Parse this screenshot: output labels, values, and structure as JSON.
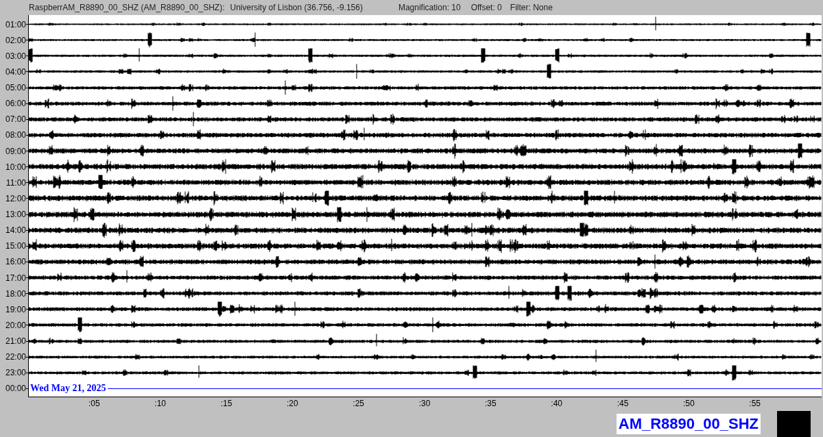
{
  "header": {
    "station": "RaspberrAM_R8890_00_SHZ (AM_R8890_00_SHZ):",
    "location": "University of Lisbon (36.756, -9.156)",
    "magnification": "Magnification: 10",
    "offset": "Offset: 0",
    "filter": "Filter: None"
  },
  "rows": [
    {
      "label": "01:00",
      "kind": "trace"
    },
    {
      "label": "02:00",
      "kind": "trace"
    },
    {
      "label": "03:00",
      "kind": "trace"
    },
    {
      "label": "04:00",
      "kind": "trace"
    },
    {
      "label": "05:00",
      "kind": "trace"
    },
    {
      "label": "06:00",
      "kind": "trace"
    },
    {
      "label": "07:00",
      "kind": "trace"
    },
    {
      "label": "08:00",
      "kind": "trace"
    },
    {
      "label": "09:00",
      "kind": "trace"
    },
    {
      "label": "10:00",
      "kind": "trace"
    },
    {
      "label": "11:00",
      "kind": "trace"
    },
    {
      "label": "12:00",
      "kind": "trace"
    },
    {
      "label": "13:00",
      "kind": "trace"
    },
    {
      "label": "14:00",
      "kind": "trace"
    },
    {
      "label": "15:00",
      "kind": "trace"
    },
    {
      "label": "16:00",
      "kind": "trace"
    },
    {
      "label": "17:00",
      "kind": "trace"
    },
    {
      "label": "18:00",
      "kind": "trace"
    },
    {
      "label": "19:00",
      "kind": "trace"
    },
    {
      "label": "20:00",
      "kind": "trace"
    },
    {
      "label": "21:00",
      "kind": "trace"
    },
    {
      "label": "22:00",
      "kind": "trace"
    },
    {
      "label": "23:00",
      "kind": "trace"
    },
    {
      "label": "00:00",
      "kind": "current"
    }
  ],
  "date_label": "Wed May 21, 2025",
  "x_ticks": [
    ":05",
    ":10",
    ":15",
    ":20",
    ":25",
    ":30",
    ":35",
    ":40",
    ":45",
    ":50",
    ":55"
  ],
  "station_label": "AM_R8890_00_SHZ"
}
